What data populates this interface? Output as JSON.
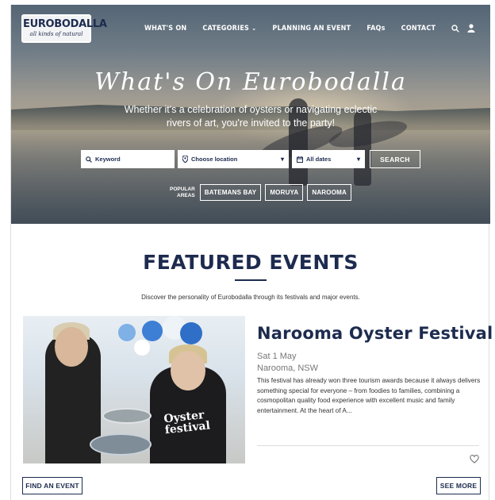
{
  "header": {
    "logo_name": "EUROBODALLA",
    "logo_tagline": "all kinds of natural",
    "nav": [
      {
        "label": "WHAT'S ON"
      },
      {
        "label": "CATEGORIES",
        "dropdown": true
      },
      {
        "label": "PLANNING AN EVENT"
      },
      {
        "label": "FAQs"
      },
      {
        "label": "CONTACT"
      }
    ],
    "icons": [
      "search-icon",
      "user-icon"
    ]
  },
  "hero": {
    "title": "What's On Eurobodalla",
    "subtitle": "Whether it's a celebration of oysters or navigating eclectic rivers of art, you're invited to the party!"
  },
  "search": {
    "keyword_placeholder": "Keyword",
    "location_label": "Choose location",
    "dates_label": "All dates",
    "button_label": "SEARCH"
  },
  "popular": {
    "label_line1": "POPULAR",
    "label_line2": "AREAS",
    "areas": [
      "BATEMANS BAY",
      "MORUYA",
      "NAROOMA"
    ]
  },
  "featured": {
    "title": "FEATURED EVENTS",
    "description": "Discover the personality of Eurobodalla through its festivals and major events.",
    "event": {
      "title": "Narooma Oyster Festival",
      "date": "Sat 1 May",
      "location": "Narooma, NSW",
      "description": "This festival has already won three tourism awards because it always delivers something special for everyone – from foodies to families, combining a cosmopolitan quality food experience with excellent music and family entertainment. At the heart of A...",
      "shirt_text": "Oyster festival"
    },
    "find_label": "FIND AN EVENT",
    "more_label": "SEE MORE"
  },
  "colors": {
    "brand_navy": "#1d2b4f",
    "muted_text": "#777777"
  }
}
